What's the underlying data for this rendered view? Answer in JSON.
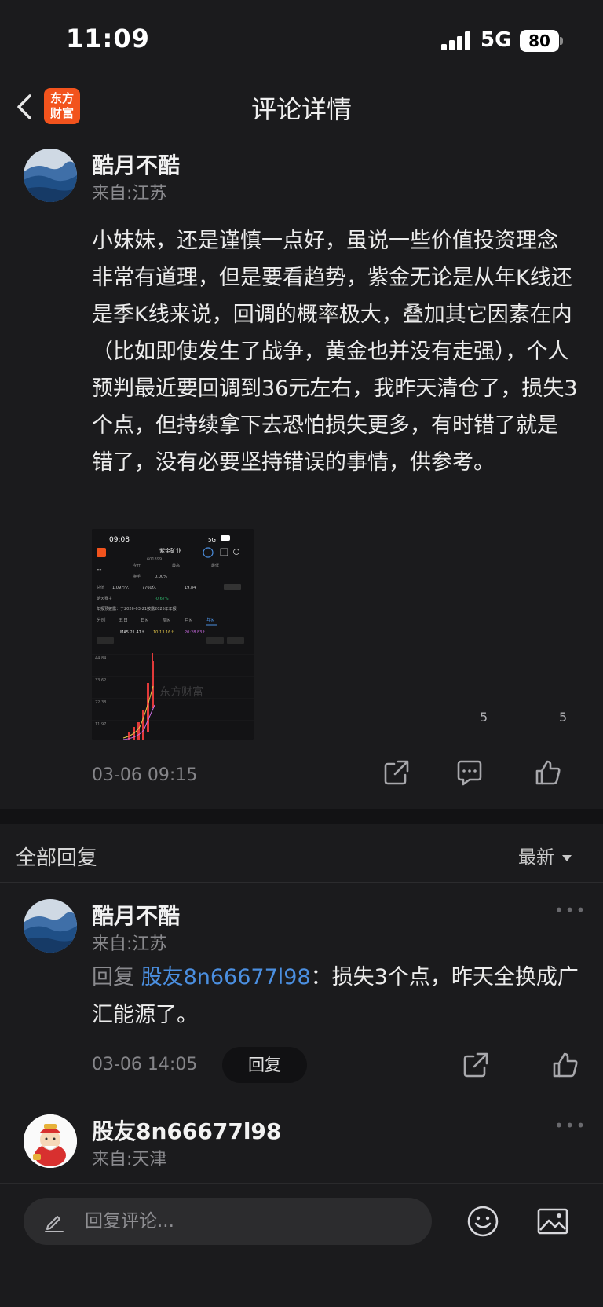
{
  "status": {
    "time": "11:09",
    "network": "5G",
    "battery": "80"
  },
  "nav": {
    "title": "评论详情",
    "logo_line1": "东方",
    "logo_line2": "财富"
  },
  "post": {
    "user": "酷月不酷",
    "location": "来自:江苏",
    "body": "小妹妹，还是谨慎一点好，虽说一些价值投资理念非常有道理，但是要看趋势，紫金无论是从年K线还是季K线来说，回调的概率极大，叠加其它因素在内（比如即使发生了战争，黄金也并没有走强），个人预判最近要回调到36元左右，我昨天清仓了，损失3个点，但持续拿下去恐怕损失更多，有时错了就是错了，没有必要坚持错误的事情，供参考。",
    "time": "03-06 09:15",
    "comment_count": "5",
    "like_count": "5",
    "image": {
      "time": "09:08",
      "network": "5G",
      "stock_name": "紫金矿业",
      "stock_code": "601899",
      "price_row": [
        "今开",
        "最高",
        "--"
      ],
      "turnover": "0.00%",
      "cap_total": "7760亿",
      "pe": "19.84",
      "announce": "年报预披露：于2026-03-21披露2025年年报",
      "tabs": [
        "分时",
        "五日",
        "日K",
        "周K",
        "月K",
        "年K"
      ],
      "ma_label": "MA5 21.47↑",
      "ma10": "10:13.16↑",
      "ma20": "20:28.83↑",
      "y_ticks": [
        "44.84",
        "33.62",
        "22.38",
        "11.97"
      ],
      "watermark": "东方财富"
    }
  },
  "replies": {
    "title": "全部回复",
    "sort": "最新",
    "items": [
      {
        "user": "酷月不酷",
        "location": "来自:江苏",
        "prefix": "回复 ",
        "mention": "股友8n66677l98",
        "text": "：损失3个点，昨天全换成广汇能源了。",
        "time": "03-06 14:05",
        "reply_label": "回复"
      },
      {
        "user": "股友8n66677l98",
        "location": "来自:天津"
      }
    ]
  },
  "bottom": {
    "placeholder": "回复评论..."
  },
  "colors": {
    "bg": "#1b1b1d",
    "accent": "#f2531d",
    "link": "#4b8fe0"
  },
  "icons": [
    "back-icon",
    "share-icon",
    "comment-icon",
    "like-icon",
    "more-icon",
    "pen-icon",
    "emoji-icon",
    "image-icon"
  ]
}
